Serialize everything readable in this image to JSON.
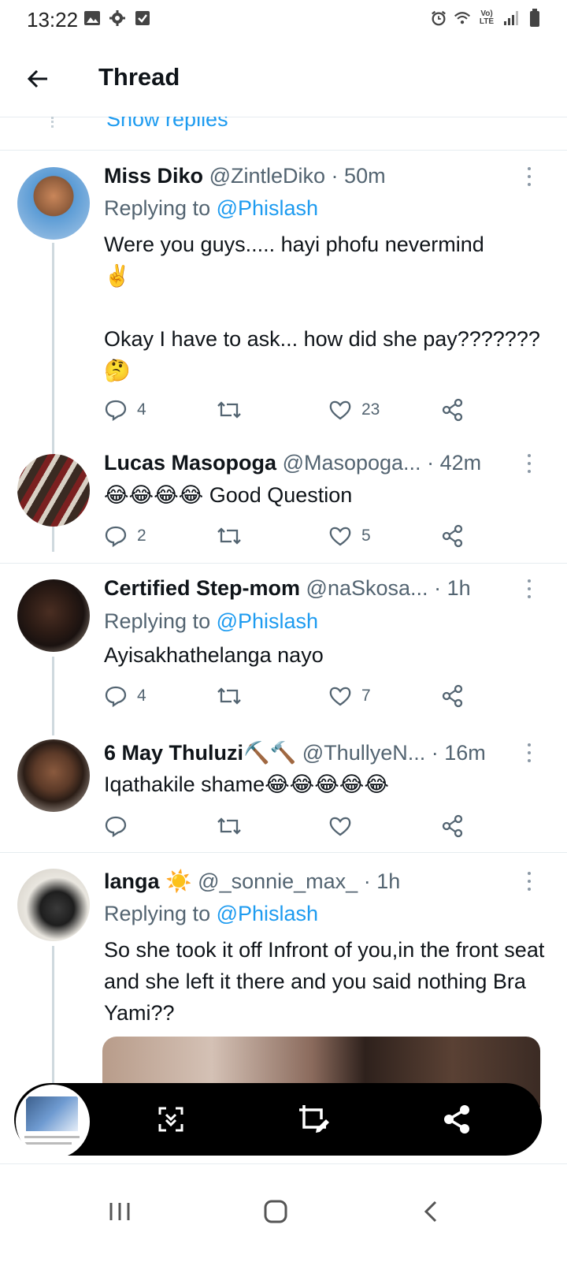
{
  "status_bar": {
    "time": "13:22",
    "left_icons": [
      "image-icon",
      "gear-icon",
      "check-box-icon"
    ],
    "right_icons": [
      "alarm-icon",
      "wifi-icon",
      "volte-icon",
      "signal-icon",
      "battery-icon"
    ],
    "volte_label": "Vo) LTE"
  },
  "header": {
    "title": "Thread"
  },
  "show_replies": {
    "label": "Show replies"
  },
  "tweets": [
    {
      "name": "Miss Diko",
      "handle": "@ZintleDiko",
      "sep": "·",
      "time": "50m",
      "replying_prefix": "Replying to",
      "replying_to": "@Phislash",
      "text_1": "Were you guys..... hayi phofu nevermind",
      "text_1_emoji": "✌️",
      "text_2": "Okay I have to ask... how did she pay???????",
      "text_2_emoji": "🤔",
      "replies": "4",
      "retweets": "",
      "likes": "23"
    },
    {
      "name": "Lucas Masopoga",
      "handle": "@Masopoga...",
      "sep": "·",
      "time": "42m",
      "text": "😂😂😂😂 Good Question",
      "replies": "2",
      "retweets": "",
      "likes": "5"
    },
    {
      "name": "Certified Step-mom",
      "handle": "@naSkosa...",
      "sep": "·",
      "time": "1h",
      "replying_prefix": "Replying to",
      "replying_to": "@Phislash",
      "text": "Ayisakhathelanga nayo",
      "replies": "4",
      "retweets": "",
      "likes": "7"
    },
    {
      "name": "6 May Thuluzi⛏️🔨",
      "handle": "@ThullyeN...",
      "sep": "·",
      "time": "16m",
      "text": "Iqathakile shame😂😂😂😂😂",
      "replies": "",
      "retweets": "",
      "likes": ""
    },
    {
      "name": "langa ☀️",
      "handle": "@_sonnie_max_",
      "sep": "·",
      "time": "1h",
      "replying_prefix": "Replying to",
      "replying_to": "@Phislash",
      "text": "So she took it off Infront of you,in the front seat and she left it there and you said nothing Bra Yami??"
    }
  ],
  "screenshot_toolbar": {
    "buttons": [
      "scroll-capture-icon",
      "crop-edit-icon",
      "share-icon"
    ]
  },
  "nav_bar": {
    "buttons": [
      "recents-icon",
      "home-icon",
      "back-icon"
    ]
  },
  "colors": {
    "accent": "#1d9bf0",
    "text_primary": "#0f1419",
    "text_secondary": "#536471",
    "divider": "#e6ecf0"
  }
}
